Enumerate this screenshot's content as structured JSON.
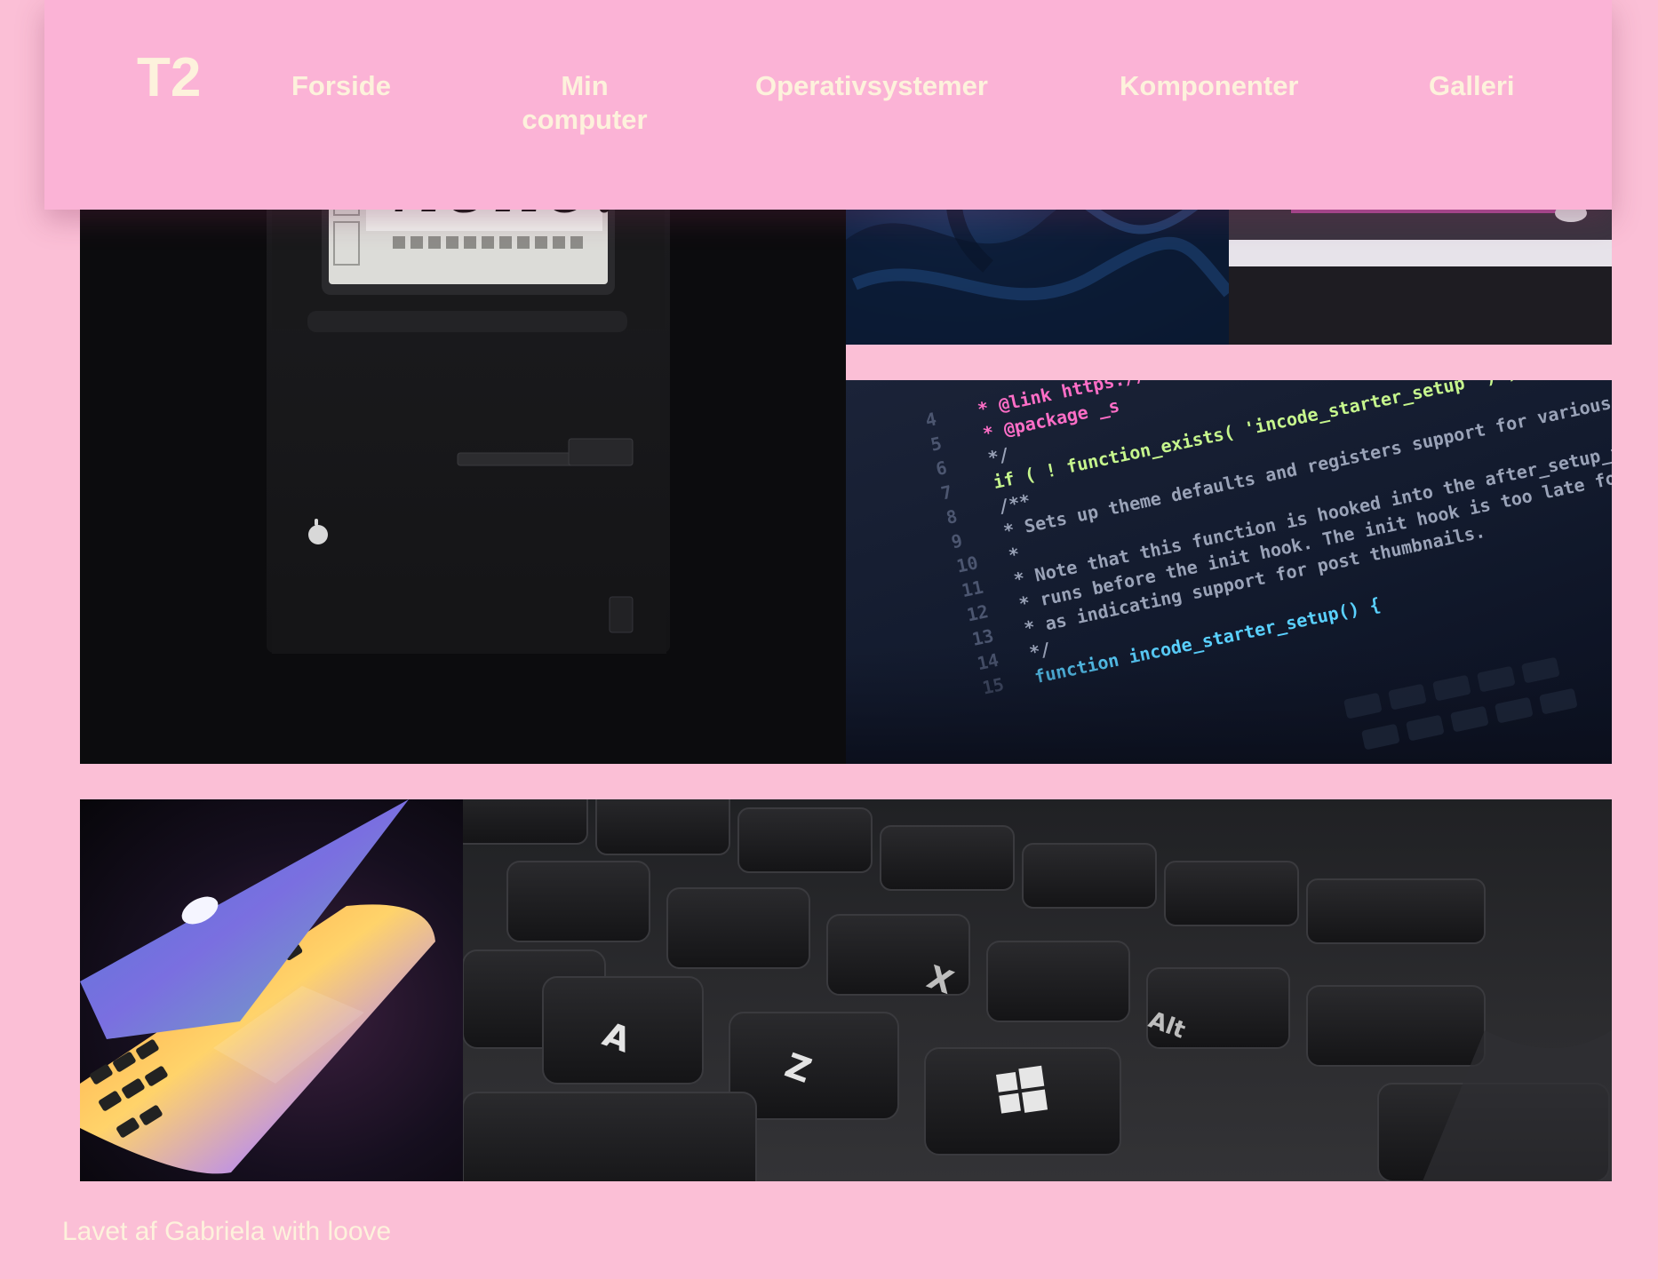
{
  "header": {
    "logo": "T2",
    "nav": [
      {
        "label": "Forside"
      },
      {
        "label": "Min computer"
      },
      {
        "label": "Operativsystemer"
      },
      {
        "label": "Komponenter"
      },
      {
        "label": "Galleri"
      }
    ]
  },
  "gallery": {
    "hello_screen_text": "hello.",
    "code_lines": [
      "* @link https://deve",
      "* @package _s",
      "*/",
      "if ( ! function_exists( 'incode_starter_setup' ) ) :",
      "/**",
      " * Sets up theme defaults and registers support for various WordPress fea",
      " *",
      " * Note that this function is hooked into the after_setup_theme hook, which",
      " * runs before the init hook. The init hook is too late for some features, s",
      " * as indicating support for post thumbnails.",
      " */",
      "function incode_starter_setup() {"
    ],
    "code_line_numbers": [
      "4",
      "5",
      "6",
      "7",
      "8",
      "9",
      "10",
      "11",
      "12",
      "13",
      "14",
      "15"
    ],
    "key_labels": [
      "A",
      "Z",
      "X",
      "Alt"
    ]
  },
  "footer": {
    "text": "Lavet af Gabriela with loove"
  },
  "colors": {
    "page_background": "#fbbfd6",
    "header_background": "#fbb3d6",
    "header_text": "#fdf2dc",
    "code_pink": "#ff6ec7",
    "code_green": "#c6f68d",
    "code_cyan": "#5ad1ff"
  }
}
